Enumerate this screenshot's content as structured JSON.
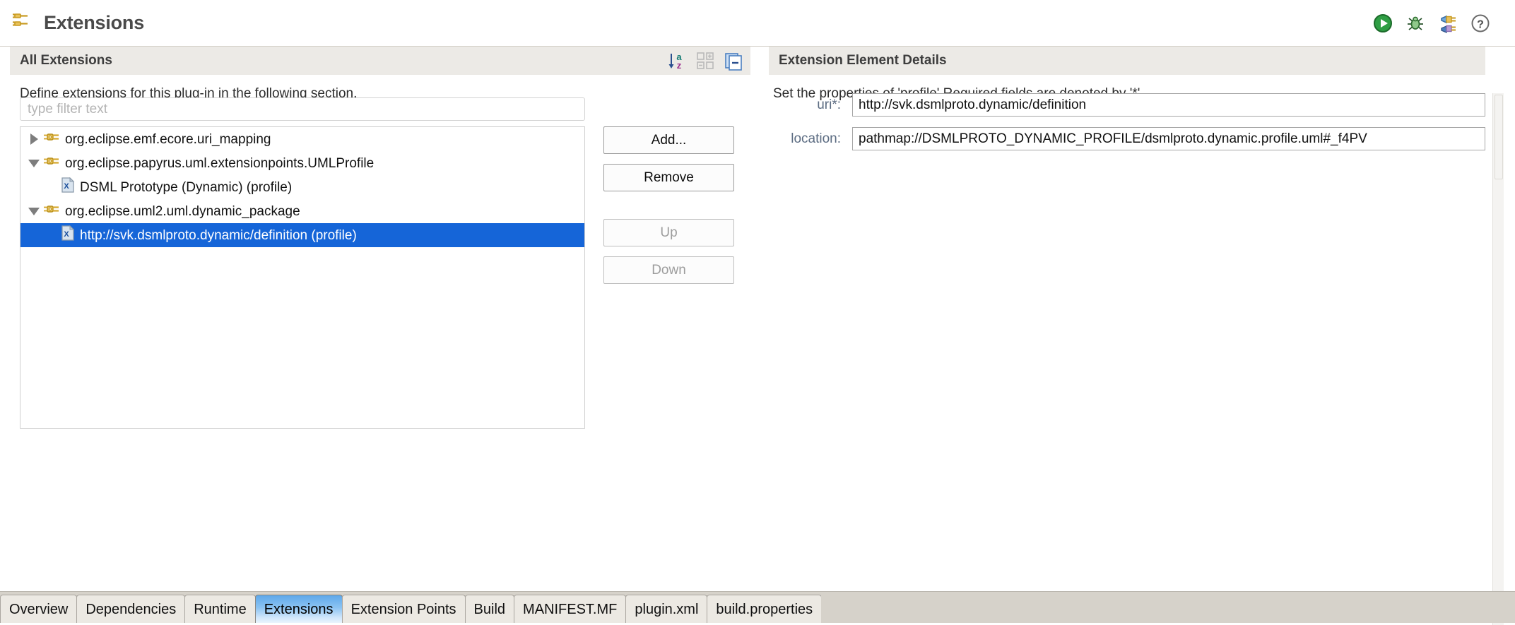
{
  "header": {
    "title": "Extensions",
    "icon": "extensions-plug-icon",
    "tools": [
      {
        "name": "run-icon",
        "label": "Run"
      },
      {
        "name": "debug-icon",
        "label": "Debug"
      },
      {
        "name": "extensions-plug-icon",
        "label": "Extensions"
      },
      {
        "name": "help-icon",
        "label": "Help"
      }
    ]
  },
  "left": {
    "section_title": "All Extensions",
    "description": "Define extensions for this plug-in in the following section.",
    "filter": {
      "value": "",
      "placeholder": "type filter text"
    },
    "tools": [
      {
        "name": "sort-az-icon",
        "label": "Sort alphabetically"
      },
      {
        "name": "expand-collapse-icon",
        "label": "Expand / Collapse"
      },
      {
        "name": "collapse-all-icon",
        "label": "Collapse All"
      }
    ],
    "tree": [
      {
        "label": "org.eclipse.emf.ecore.uri_mapping",
        "icon": "extension-point-plug-icon",
        "twisty": "closed",
        "level": 1,
        "selected": false
      },
      {
        "label": "org.eclipse.papyrus.uml.extensionpoints.UMLProfile",
        "icon": "extension-point-plug-icon",
        "twisty": "open",
        "level": 1,
        "selected": false
      },
      {
        "label": "DSML Prototype (Dynamic) (profile)",
        "icon": "xml-element-icon",
        "twisty": "none",
        "level": 2,
        "selected": false
      },
      {
        "label": "org.eclipse.uml2.uml.dynamic_package",
        "icon": "extension-point-plug-icon",
        "twisty": "open",
        "level": 1,
        "selected": false
      },
      {
        "label": "http://svk.dsmlproto.dynamic/definition (profile)",
        "icon": "xml-element-icon",
        "twisty": "none",
        "level": 2,
        "selected": true
      }
    ],
    "buttons": [
      {
        "label": "Add...",
        "name": "add-button",
        "enabled": true,
        "gap": false
      },
      {
        "label": "Remove",
        "name": "remove-button",
        "enabled": true,
        "gap": false
      },
      {
        "label": "Up",
        "name": "up-button",
        "enabled": false,
        "gap": true
      },
      {
        "label": "Down",
        "name": "down-button",
        "enabled": false,
        "gap": false
      }
    ]
  },
  "right": {
    "section_title": "Extension Element Details",
    "description": "Set the properties of 'profile' Required fields are denoted by '*'.",
    "fields": [
      {
        "label": "uri*:",
        "name": "uri-field",
        "value": "http://svk.dsmlproto.dynamic/definition"
      },
      {
        "label": "location:",
        "name": "location-field",
        "value": "pathmap://DSMLPROTO_DYNAMIC_PROFILE/dsmlproto.dynamic.profile.uml#_f4PV"
      }
    ]
  },
  "tabs": [
    {
      "label": "Overview",
      "active": false
    },
    {
      "label": "Dependencies",
      "active": false
    },
    {
      "label": "Runtime",
      "active": false
    },
    {
      "label": "Extensions",
      "active": true
    },
    {
      "label": "Extension Points",
      "active": false
    },
    {
      "label": "Build",
      "active": false
    },
    {
      "label": "MANIFEST.MF",
      "active": false
    },
    {
      "label": "plugin.xml",
      "active": false
    },
    {
      "label": "build.properties",
      "active": false
    }
  ],
  "colors": {
    "selection_blue": "#1565d8",
    "section_header_bg": "#eceae6",
    "field_label": "#5c6c82",
    "tab_bar_bg": "#d6d2ca",
    "active_tab_blue": "#5ea8ea"
  }
}
